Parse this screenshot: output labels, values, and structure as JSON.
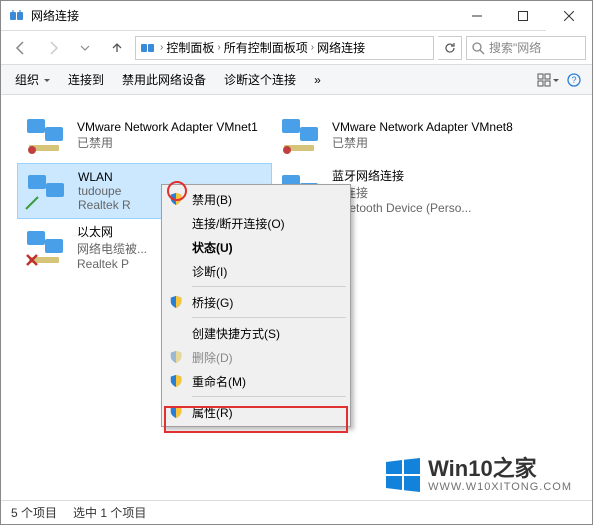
{
  "window": {
    "title": "网络连接"
  },
  "breadcrumb": {
    "items": [
      "控制面板",
      "所有控制面板项",
      "网络连接"
    ]
  },
  "search": {
    "placeholder": "搜索\"网络"
  },
  "toolbar": {
    "organize": "组织",
    "connect": "连接到",
    "disable": "禁用此网络设备",
    "diagnose": "诊断这个连接"
  },
  "adapters": [
    {
      "name": "VMware Network Adapter VMnet1",
      "line2": "已禁用",
      "line3": ""
    },
    {
      "name": "VMware Network Adapter VMnet8",
      "line2": "已禁用",
      "line3": ""
    },
    {
      "name": "WLAN",
      "line2": "tudoupe",
      "line3": "Realtek R",
      "selected": true
    },
    {
      "name": "蓝牙网络连接",
      "line2": "未连接",
      "line3": "Bluetooth Device (Perso..."
    },
    {
      "name": "以太网",
      "line2": "网络电缆被...",
      "line3": "Realtek P"
    }
  ],
  "context_menu": {
    "items": [
      {
        "label": "禁用(B)",
        "shield": true
      },
      {
        "label": "连接/断开连接(O)"
      },
      {
        "label": "状态(U)",
        "bold": true
      },
      {
        "label": "诊断(I)"
      },
      {
        "sep": true
      },
      {
        "label": "桥接(G)",
        "shield": true
      },
      {
        "sep": true
      },
      {
        "label": "创建快捷方式(S)"
      },
      {
        "label": "删除(D)",
        "shield": true,
        "disabled": true
      },
      {
        "label": "重命名(M)",
        "shield": true
      },
      {
        "sep": true
      },
      {
        "label": "属性(R)",
        "shield": true,
        "highlighted": true
      }
    ]
  },
  "status": {
    "items_count": "5 个项目",
    "selected_count": "选中 1 个项目"
  },
  "watermark": {
    "text1": "Win10之家",
    "text2": "WWW.W10XITONG.COM"
  }
}
